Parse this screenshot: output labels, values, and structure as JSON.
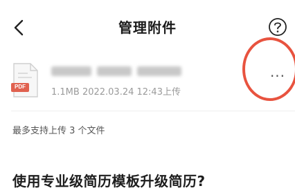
{
  "header": {
    "title": "管理附件",
    "back_icon": "chevron-left-icon",
    "help_icon": "question-circle-icon"
  },
  "attachment": {
    "file_type_icon": "pdf-file-icon",
    "file_type_label": "PDF",
    "meta": "1.1MB 2022.03.24 12:43上传",
    "more_icon": "more-horizontal-icon",
    "more_label": "···"
  },
  "upload_limit_text": "最多支持上传 3 个文件",
  "promo_title": "使用专业级简历模板升级简历?",
  "colors": {
    "pdf_red": "#e0614f",
    "annotation_red": "#e8533f",
    "meta_gray": "#9a9a9a"
  }
}
